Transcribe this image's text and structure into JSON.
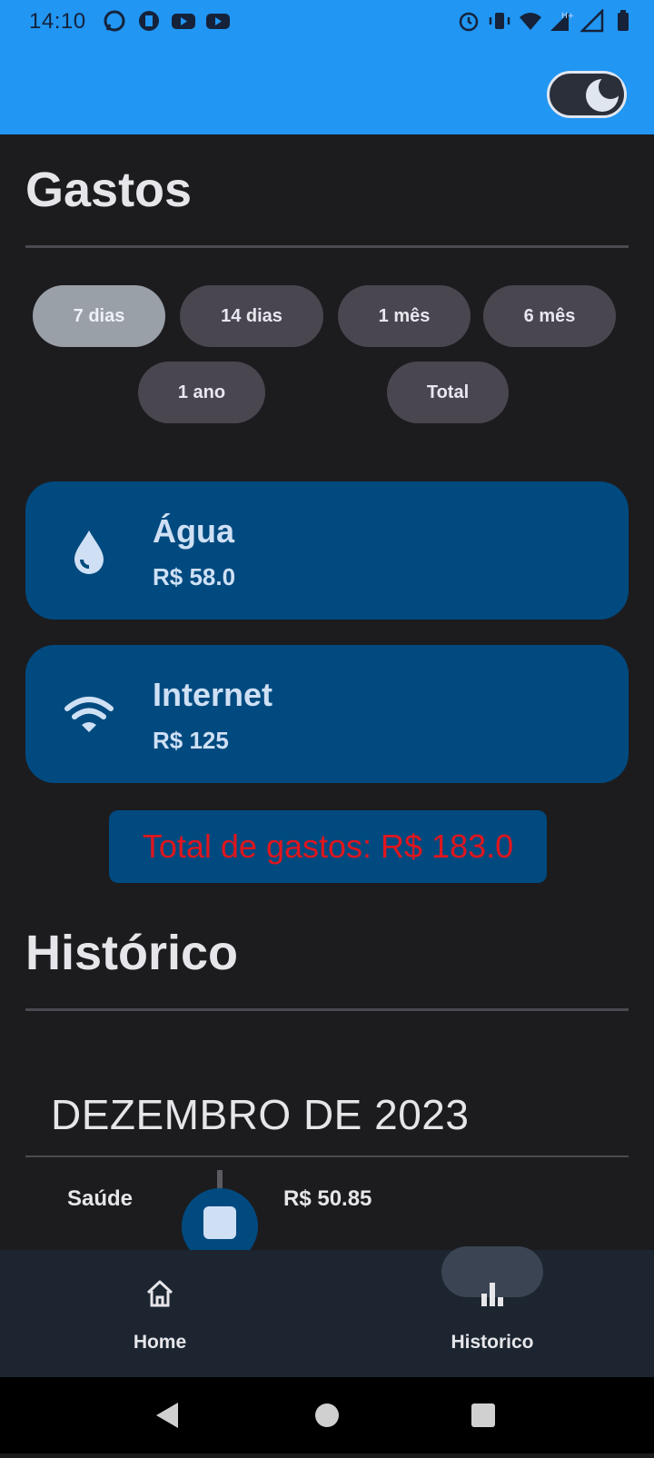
{
  "status": {
    "time": "14:10",
    "left_icons": [
      "whatsapp-icon",
      "app-icon",
      "youtube-icon",
      "youtube-icon"
    ],
    "right_icons": [
      "alarm-icon",
      "vibrate-icon",
      "wifi-icon",
      "signal-h-plus-icon",
      "signal-icon",
      "battery-icon"
    ]
  },
  "header": {
    "theme_toggle_icon": "moon-icon",
    "bar_color": "#2196f3"
  },
  "gastos": {
    "title": "Gastos",
    "filters": [
      "7 dias",
      "14 dias",
      "1 mês",
      "6 mês",
      "1 ano",
      "Total"
    ],
    "selected_filter": "7 dias",
    "cards": [
      {
        "icon": "water-drop-icon",
        "name": "Água",
        "value": "R$ 58.0"
      },
      {
        "icon": "wifi-icon",
        "name": "Internet",
        "value": "R$ 125"
      }
    ],
    "total": "Total de gastos: R$ 183.0"
  },
  "historico": {
    "title": "Histórico",
    "month": "DEZEMBRO DE 2023",
    "entries": [
      {
        "label": "Saúde",
        "icon": "medical-icon",
        "value": "R$ 50.85"
      }
    ]
  },
  "nav": {
    "items": [
      {
        "label": "Home",
        "icon": "home-icon"
      },
      {
        "label": "Historico",
        "icon": "bar-chart-icon"
      }
    ],
    "active": "Historico"
  },
  "system_nav": [
    "back-icon",
    "home-circle-icon",
    "recents-icon"
  ],
  "colors": {
    "accent": "#004a7f",
    "total_text": "#e0161e",
    "background": "#1c1c1f"
  }
}
